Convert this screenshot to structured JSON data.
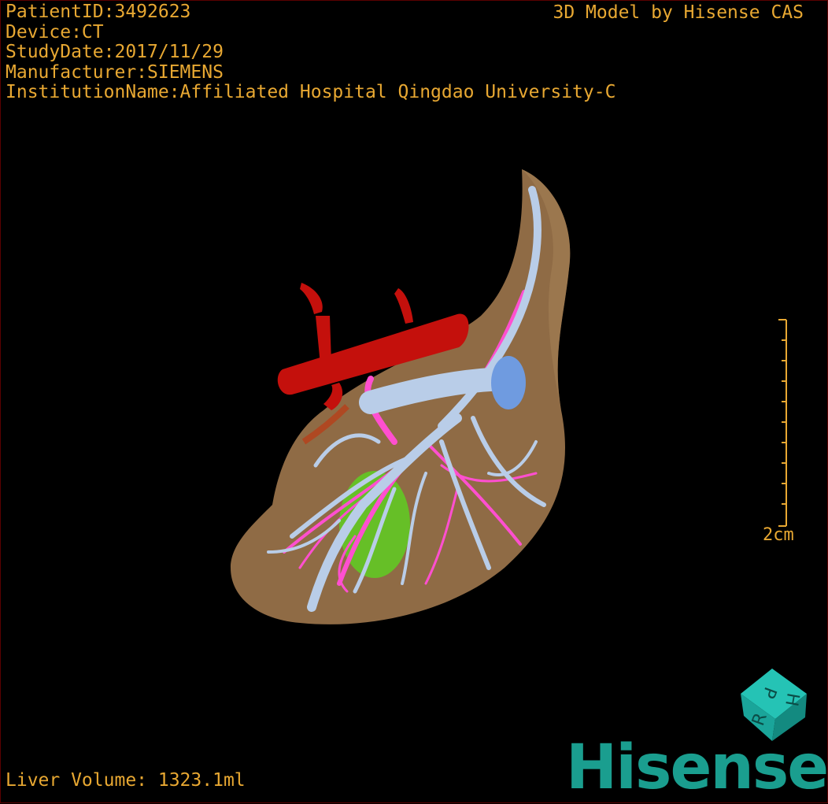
{
  "header": {
    "patient_id": "PatientID:3492623",
    "device": "Device:CT",
    "study_date": "StudyDate:2017/11/29",
    "manufacturer": "Manufacturer:SIEMENS",
    "institution": "InstitutionName:Affiliated Hospital Qingdao University-C",
    "title": "3D Model by Hisense CAS"
  },
  "footer": {
    "liver_volume": "Liver Volume: 1323.1ml"
  },
  "scale_bar": {
    "label": "2cm"
  },
  "orientation_cube": {
    "faces": [
      "P",
      "R",
      "H"
    ],
    "color": "#1aa59a"
  },
  "brand": {
    "name": "Hisense",
    "color": "#1a9e8f"
  },
  "colors": {
    "text": "#e8a832",
    "liver": "#8f6b45",
    "artery": "#c4100c",
    "portal_vein": "#b9cde8",
    "hepatic_vein": "#ff4fd0",
    "gallbladder": "#5fce22"
  }
}
